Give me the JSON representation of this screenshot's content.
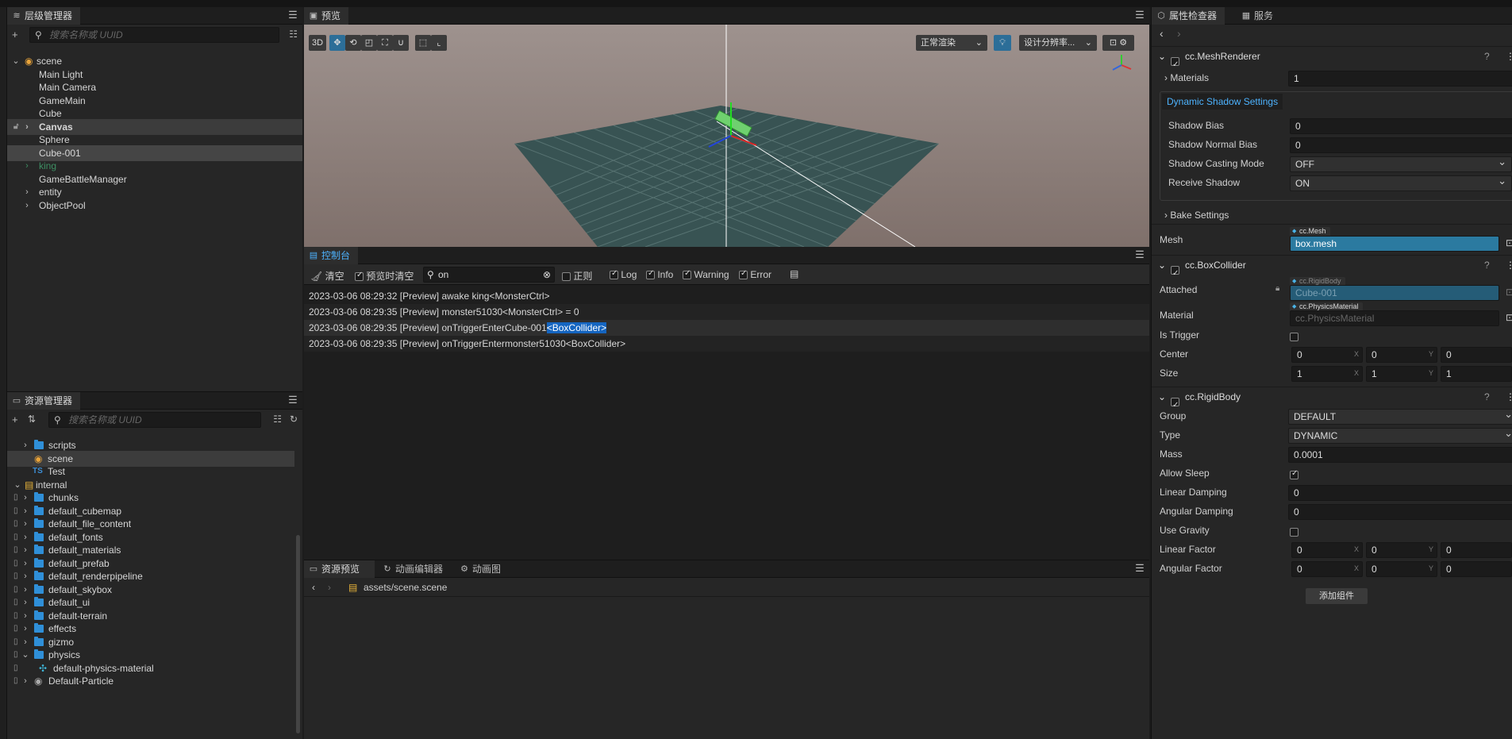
{
  "hierarchy": {
    "tab_label": "层级管理器",
    "search_placeholder": "搜索名称或 UUID",
    "root": "scene",
    "nodes": [
      "Main Light",
      "Main Camera",
      "GameMain",
      "Cube",
      "Canvas",
      "Sphere",
      "Cube-001",
      "king",
      "GameBattleManager",
      "entity",
      "ObjectPool"
    ]
  },
  "assets": {
    "tab_label": "资源管理器",
    "search_placeholder": "搜索名称或 UUID",
    "items": [
      "scripts",
      "scene",
      "Test",
      "internal",
      "chunks",
      "default_cubemap",
      "default_file_content",
      "default_fonts",
      "default_materials",
      "default_prefab",
      "default_renderpipeline",
      "default_skybox",
      "default_ui",
      "default-terrain",
      "effects",
      "gizmo",
      "physics",
      "default-physics-material",
      "Default-Particle"
    ],
    "ts_badge": "TS"
  },
  "scene_view": {
    "tab_label": "预览",
    "btn_3d": "3D",
    "render_mode": "正常渲染",
    "resolution": "设计分辨率..."
  },
  "console": {
    "tab_label": "控制台",
    "clear": "清空",
    "clear_on_preview": "预览时清空",
    "filter_value": "on",
    "regex": "正则",
    "log": "Log",
    "info": "Info",
    "warning": "Warning",
    "error": "Error",
    "lines": [
      "2023-03-06 08:29:32 [Preview] awake king<MonsterCtrl>",
      "2023-03-06 08:29:35 [Preview] monster51030<MonsterCtrl> = 0",
      "2023-03-06 08:29:35 [Preview] onTriggerEnterCube-001",
      "<BoxCollider>",
      "2023-03-06 08:29:35 [Preview] onTriggerEntermonster51030<BoxCollider>"
    ]
  },
  "bottom": {
    "tabs": [
      "资源预览",
      "动画编辑器",
      "动画图"
    ],
    "path_prefix": "assets",
    "path_sep": "/",
    "path_file": "scene.scene"
  },
  "inspector": {
    "tabs": [
      "属性检查器",
      "服务"
    ],
    "mesh_renderer": {
      "title": "cc.MeshRenderer",
      "materials_label": "Materials",
      "materials_value": "1",
      "dynamic_shadow": "Dynamic Shadow Settings",
      "shadow_bias_label": "Shadow Bias",
      "shadow_bias": "0",
      "shadow_normal_bias_label": "Shadow Normal Bias",
      "shadow_normal_bias": "0",
      "casting_label": "Shadow Casting Mode",
      "casting": "OFF",
      "receive_label": "Receive Shadow",
      "receive": "ON",
      "bake_label": "Bake Settings",
      "mesh_label": "Mesh",
      "mesh_tag": "cc.Mesh",
      "mesh_value": "box.mesh"
    },
    "box_collider": {
      "title": "cc.BoxCollider",
      "attached_label": "Attached",
      "attached_tag": "cc.RigidBody",
      "attached_value": "Cube-001",
      "material_label": "Material",
      "material_tag": "cc.PhysicsMaterial",
      "material_value": "cc.PhysicsMaterial",
      "trigger_label": "Is Trigger",
      "center_label": "Center",
      "center": [
        "0",
        "0",
        "0"
      ],
      "size_label": "Size",
      "size": [
        "1",
        "1",
        "1"
      ]
    },
    "rigid_body": {
      "title": "cc.RigidBody",
      "group_label": "Group",
      "group": "DEFAULT",
      "type_label": "Type",
      "type": "DYNAMIC",
      "mass_label": "Mass",
      "mass": "0.0001",
      "allow_sleep_label": "Allow Sleep",
      "linear_damping_label": "Linear Damping",
      "linear_damping": "0",
      "angular_damping_label": "Angular Damping",
      "angular_damping": "0",
      "use_gravity_label": "Use Gravity",
      "linear_factor_label": "Linear Factor",
      "linear_factor": [
        "0",
        "0",
        "0"
      ],
      "angular_factor_label": "Angular Factor",
      "angular_factor": [
        "0",
        "0",
        "0"
      ]
    },
    "add_component": "添加组件",
    "axis_x": "X",
    "axis_y": "Y"
  }
}
